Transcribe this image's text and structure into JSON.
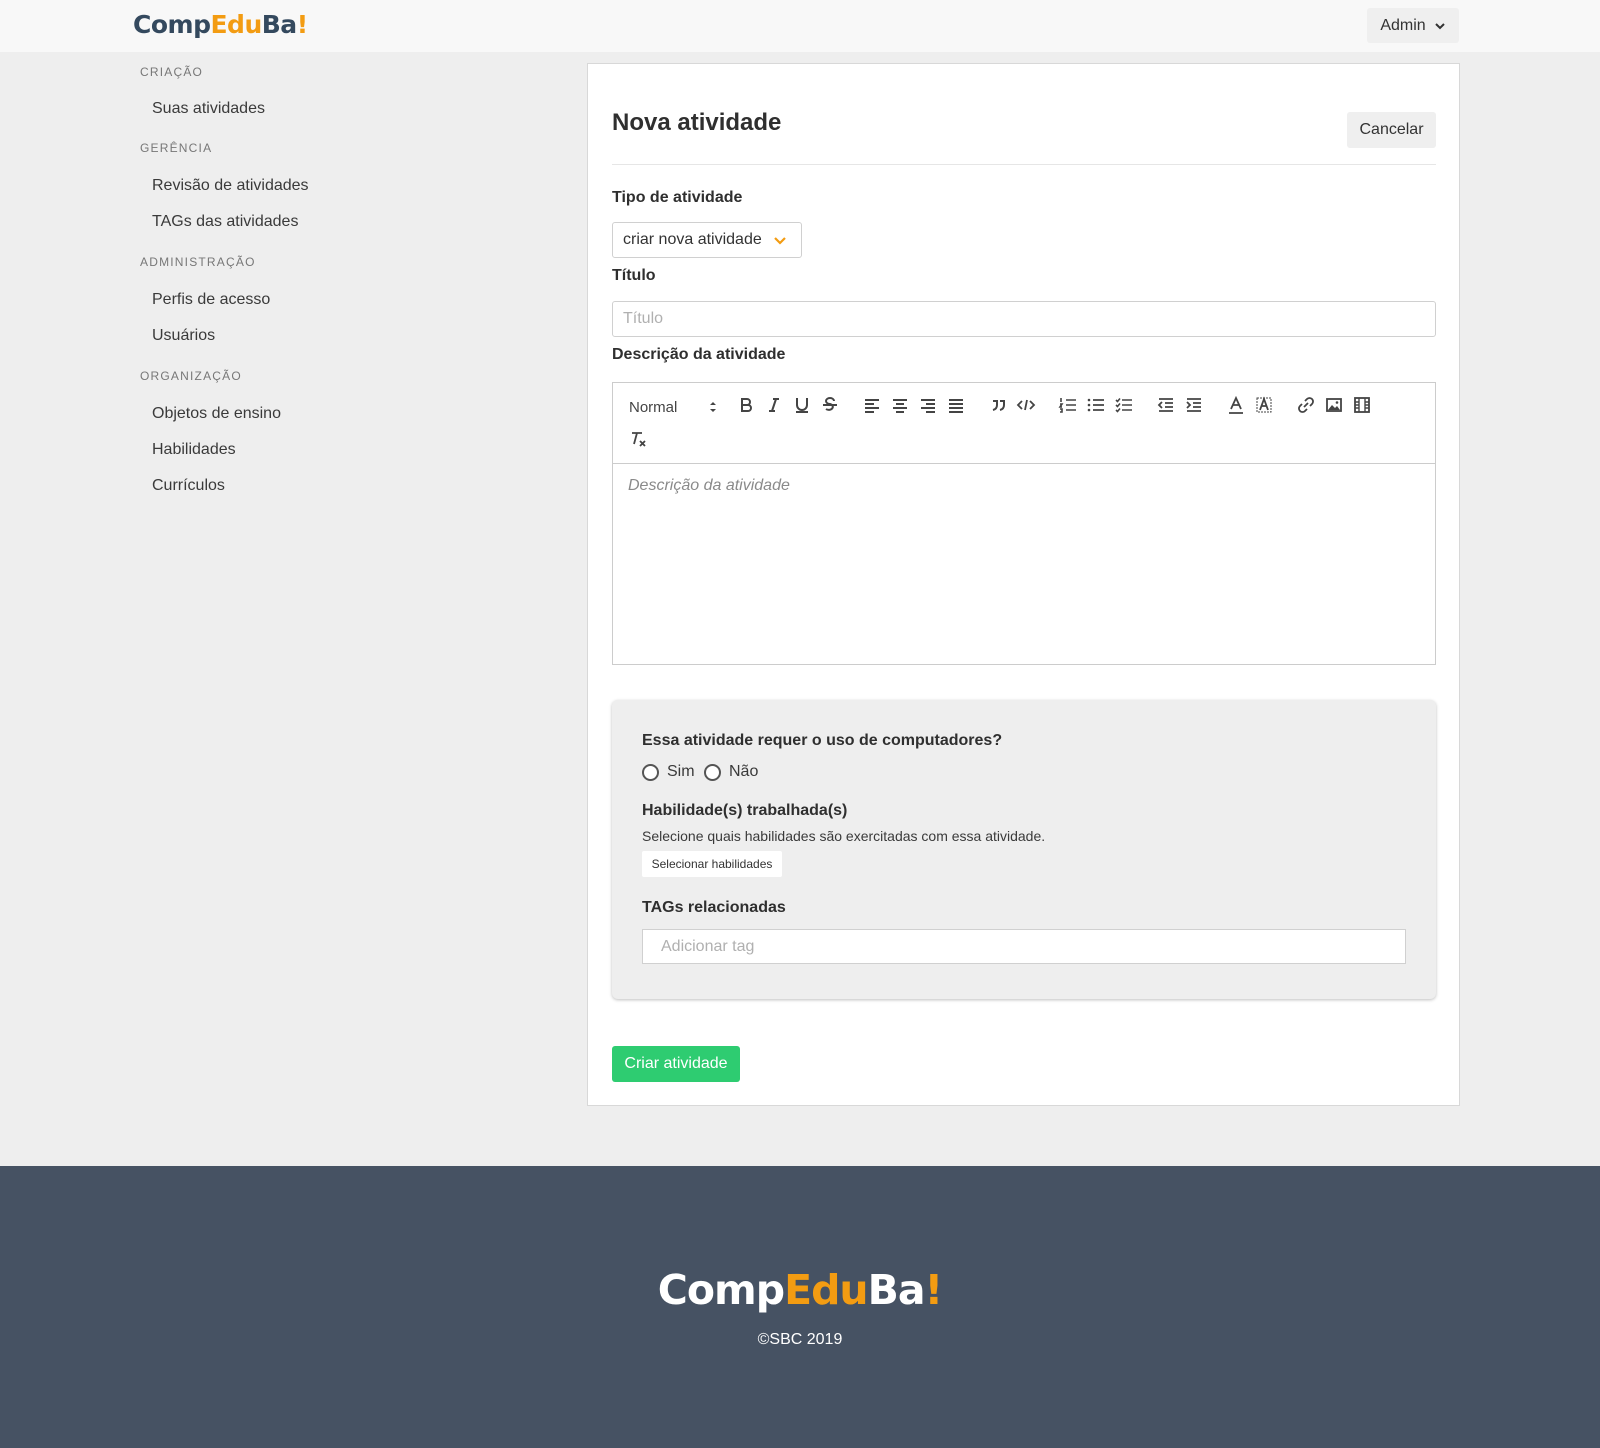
{
  "brand": {
    "part1": "Comp",
    "part2": "Edu",
    "part3": "Ba",
    "part4": "!"
  },
  "header": {
    "user_menu": "Admin"
  },
  "sidebar": {
    "sections": [
      {
        "title": "CRIAÇÃO",
        "items": [
          "Suas atividades"
        ]
      },
      {
        "title": "GERÊNCIA",
        "items": [
          "Revisão de atividades",
          "TAGs das atividades"
        ]
      },
      {
        "title": "ADMINISTRAÇÃO",
        "items": [
          "Perfis de acesso",
          "Usuários"
        ]
      },
      {
        "title": "ORGANIZAÇÃO",
        "items": [
          "Objetos de ensino",
          "Habilidades",
          "Currículos"
        ]
      }
    ]
  },
  "form": {
    "title": "Nova atividade",
    "cancel_label": "Cancelar",
    "type_label": "Tipo de atividade",
    "type_value": "criar nova atividade",
    "title_label": "Título",
    "title_placeholder": "Título",
    "description_label": "Descrição da atividade",
    "editor": {
      "header_value": "Normal",
      "placeholder": "Descrição da atividade",
      "tools": [
        "bold-icon",
        "italic-icon",
        "underline-icon",
        "strike-icon",
        "align-left-icon",
        "align-center-icon",
        "align-right-icon",
        "align-justify-icon",
        "blockquote-icon",
        "code-icon",
        "ordered-list-icon",
        "bullet-list-icon",
        "check-list-icon",
        "outdent-icon",
        "indent-icon",
        "text-color-icon",
        "background-color-icon",
        "link-icon",
        "image-icon",
        "video-icon",
        "clear-format-icon"
      ]
    },
    "computer_question": "Essa atividade requer o uso de computadores?",
    "computer_options": [
      "Sim",
      "Não"
    ],
    "skills_label": "Habilidade(s) trabalhada(s)",
    "skills_help": "Selecione quais habilidades são exercitadas com essa atividade.",
    "skills_button": "Selecionar habilidades",
    "tags_label": "TAGs relacionadas",
    "tags_placeholder": "Adicionar tag",
    "submit_label": "Criar atividade"
  },
  "footer": {
    "copyright": "©SBC 2019"
  },
  "colors": {
    "accent": "#f39c12",
    "brand_dark": "#34495e",
    "success": "#2ecc71",
    "footer_bg": "#465263"
  }
}
